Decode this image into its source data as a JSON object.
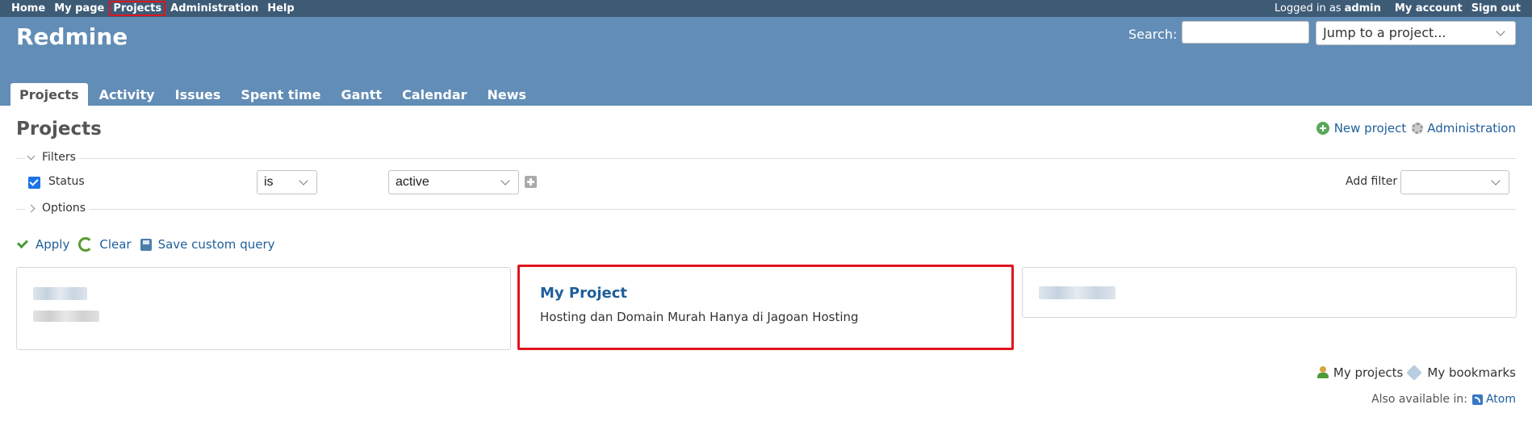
{
  "top_menu": {
    "items": [
      "Home",
      "My page",
      "Projects",
      "Administration",
      "Help"
    ],
    "logged_in_prefix": "Logged in as",
    "user": "admin",
    "my_account": "My account",
    "sign_out": "Sign out"
  },
  "header": {
    "title": "Redmine",
    "search_label": "Search:",
    "search_value": "",
    "jump_placeholder": "Jump to a project..."
  },
  "tabs": [
    "Projects",
    "Activity",
    "Issues",
    "Spent time",
    "Gantt",
    "Calendar",
    "News"
  ],
  "page": {
    "title": "Projects",
    "new_project": "New project",
    "administration": "Administration"
  },
  "filters": {
    "legend": "Filters",
    "status_label": "Status",
    "status_checked": true,
    "operator": "is",
    "value": "active",
    "add_filter_label": "Add filter",
    "add_filter_value": "",
    "options_legend": "Options"
  },
  "buttons": {
    "apply": "Apply",
    "clear": "Clear",
    "save": "Save custom query"
  },
  "projects": [
    {
      "name": "",
      "description": "",
      "redacted": true
    },
    {
      "name": "My Project",
      "description": "Hosting dan Domain Murah Hanya di Jagoan Hosting",
      "redacted": false
    },
    {
      "name": "",
      "description": "",
      "redacted": true
    }
  ],
  "bottom": {
    "my_projects": "My projects",
    "my_bookmarks": "My bookmarks",
    "also_available": "Also available in:",
    "atom": "Atom"
  },
  "colors": {
    "top_menu_bg": "#3e5b76",
    "header_bg": "#628db6",
    "link": "#1f5f9a",
    "highlight": "#e0141e"
  }
}
